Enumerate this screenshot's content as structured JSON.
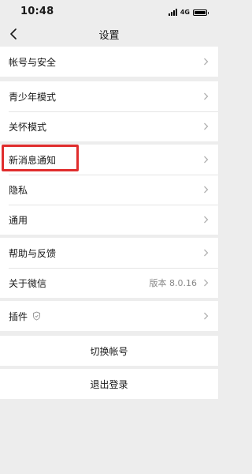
{
  "status_bar": {
    "time": "10:48",
    "network": "4G"
  },
  "nav": {
    "title": "设置",
    "back_icon": "chevron-left-icon"
  },
  "groups": [
    {
      "items": [
        {
          "label": "帐号与安全"
        }
      ]
    },
    {
      "items": [
        {
          "label": "青少年模式"
        },
        {
          "label": "关怀模式"
        }
      ]
    },
    {
      "items": [
        {
          "label": "新消息通知"
        },
        {
          "label": "隐私"
        },
        {
          "label": "通用"
        }
      ]
    },
    {
      "items": [
        {
          "label": "帮助与反馈"
        },
        {
          "label": "关于微信",
          "value": "版本 8.0.16"
        }
      ]
    },
    {
      "items": [
        {
          "label": "插件",
          "badge_icon": "shield-icon"
        }
      ]
    }
  ],
  "actions": {
    "switch_account": "切换帐号",
    "logout": "退出登录"
  },
  "colors": {
    "background": "#ededed",
    "highlight_border": "#e02d2d",
    "chevron": "#b2b2b2"
  }
}
